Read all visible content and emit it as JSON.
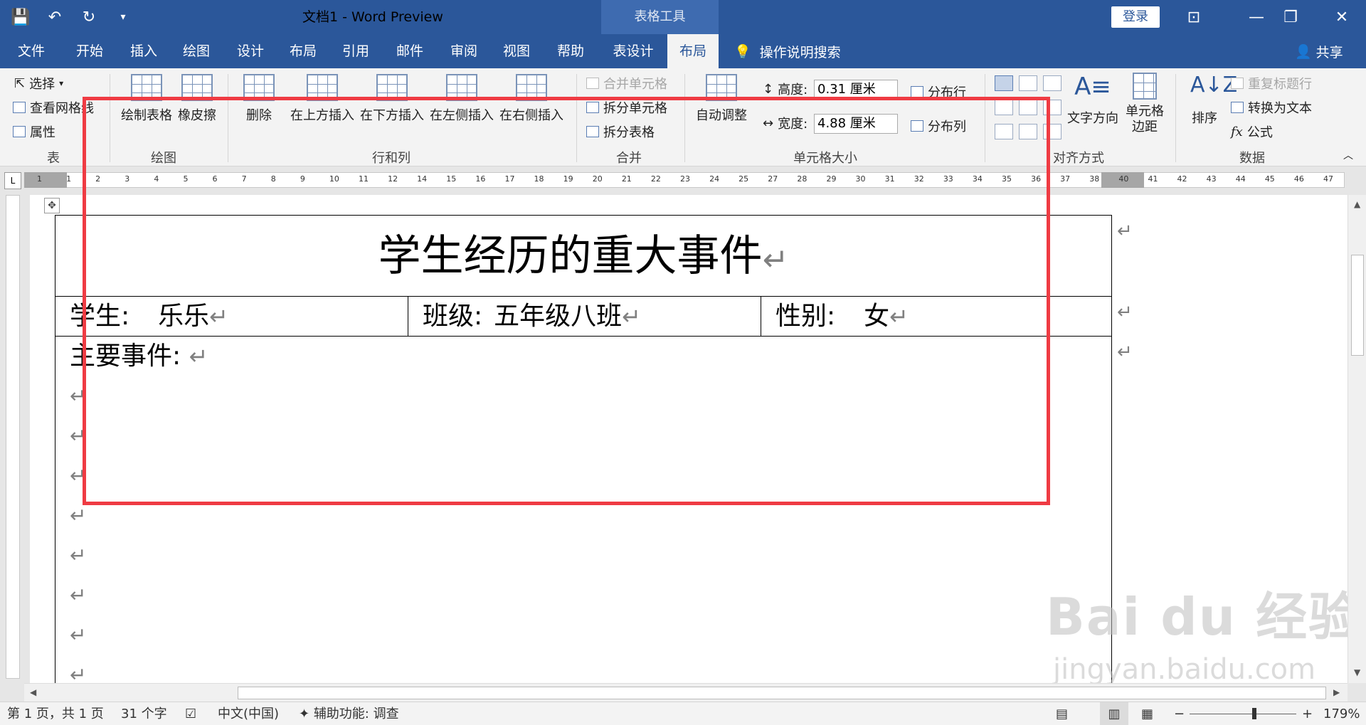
{
  "window": {
    "title": "文档1  -  Word Preview",
    "context_group": "表格工具",
    "login": "登录"
  },
  "tabs": [
    {
      "label": "文件"
    },
    {
      "label": "开始"
    },
    {
      "label": "插入"
    },
    {
      "label": "绘图"
    },
    {
      "label": "设计"
    },
    {
      "label": "布局"
    },
    {
      "label": "引用"
    },
    {
      "label": "邮件"
    },
    {
      "label": "审阅"
    },
    {
      "label": "视图"
    },
    {
      "label": "帮助"
    },
    {
      "label": "表设计"
    },
    {
      "label": "布局"
    }
  ],
  "tell_me": "操作说明搜索",
  "share": "共享",
  "ribbon": {
    "table": {
      "select": "选择",
      "gridlines": "查看网格线",
      "properties": "属性",
      "label": "表"
    },
    "draw": {
      "draw_table": "绘制表格",
      "eraser": "橡皮擦",
      "label": "绘图"
    },
    "rows_cols": {
      "delete": "删除",
      "insert_above": "在上方插入",
      "insert_below": "在下方插入",
      "insert_left": "在左侧插入",
      "insert_right": "在右侧插入",
      "label": "行和列"
    },
    "merge": {
      "merge_cells": "合并单元格",
      "split_cells": "拆分单元格",
      "split_table": "拆分表格",
      "label": "合并"
    },
    "cell_size": {
      "autofit": "自动调整",
      "height_label": "高度:",
      "height_value": "0.31 厘米",
      "width_label": "宽度:",
      "width_value": "4.88 厘米",
      "distribute_rows": "分布行",
      "distribute_cols": "分布列",
      "label": "单元格大小"
    },
    "alignment": {
      "text_direction": "文字方向",
      "cell_margins": "单元格\n边距",
      "label": "对齐方式"
    },
    "sort": "排序",
    "data": {
      "repeat_header": "重复标题行",
      "convert_text": "转换为文本",
      "formula": "公式",
      "label": "数据"
    }
  },
  "ruler_numbers": [
    "1",
    "1",
    "2",
    "3",
    "4",
    "5",
    "6",
    "7",
    "8",
    "9",
    "10",
    "11",
    "12",
    "14",
    "15",
    "16",
    "17",
    "18",
    "19",
    "20",
    "21",
    "22",
    "23",
    "24",
    "25",
    "27",
    "28",
    "29",
    "30",
    "31",
    "32",
    "33",
    "34",
    "35",
    "36",
    "37",
    "38",
    "40",
    "41",
    "42",
    "43",
    "44",
    "45",
    "46",
    "47"
  ],
  "document": {
    "title": "学生经历的重大事件",
    "cells": [
      {
        "label": "学生:",
        "value": "乐乐"
      },
      {
        "label": "班级:",
        "value": "五年级八班"
      },
      {
        "label": "性别:",
        "value": "女"
      }
    ],
    "main_label": "主要事件:",
    "para_mark": "↵"
  },
  "status": {
    "page": "第 1 页，共 1 页",
    "words": "31 个字",
    "language": "中文(中国)",
    "accessibility": "辅助功能: 调查",
    "zoom": "179%"
  },
  "watermark": {
    "main": "Bai du 经验",
    "sub": "jingyan.baidu.com"
  },
  "colors": {
    "brand": "#2b579a",
    "highlight": "#ef3b43"
  }
}
